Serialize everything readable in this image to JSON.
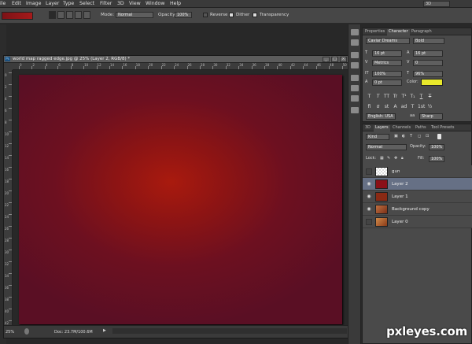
{
  "menu": {
    "items": [
      "ile",
      "Edit",
      "Image",
      "Layer",
      "Type",
      "Select",
      "Filter",
      "3D",
      "View",
      "Window",
      "Help"
    ],
    "workspace": "3D"
  },
  "options_bar": {
    "mode_label": "Mode:",
    "mode_value": "Normal",
    "opacity_label": "Opacity:",
    "opacity_value": "100%",
    "reverse_label": "Reverse",
    "dither_label": "Dither",
    "transparency_label": "Transparency",
    "reverse_checked": false,
    "dither_checked": true,
    "transparency_checked": true,
    "gradient_colors": [
      "#7d1216",
      "#a51a1a"
    ]
  },
  "document": {
    "title": "world map ragged edge.jpg @ 25% (Layer 2, RGB/8) *",
    "ps_icon": "Ps",
    "ruler_labels": [
      "0",
      "2",
      "4",
      "6",
      "8",
      "10",
      "12",
      "14",
      "16",
      "18",
      "20",
      "22",
      "24",
      "26",
      "28",
      "30",
      "32",
      "34",
      "36",
      "38",
      "40",
      "42",
      "44",
      "46",
      "48",
      "50"
    ],
    "zoom": "25%",
    "doc_size": "Doc: 23.7M/100.6M",
    "canvas_colors": {
      "center": "#a91a0e",
      "edge": "#5a0f24"
    }
  },
  "char_panel": {
    "tabs": [
      "Properties",
      "Character",
      "Paragraph"
    ],
    "active_tab": "Character",
    "font_family": "Caviar Dreams",
    "font_style": "Bold",
    "font_size": "16 pt",
    "leading": "16 pt",
    "kerning": "Metrics",
    "tracking": "0",
    "vertical_scale": "100%",
    "horizontal_scale": "96%",
    "baseline_shift": "0 pt",
    "color_label": "Color:",
    "color_value": "#e8e82b",
    "format_buttons": [
      "T",
      "T",
      "TT",
      "Tr",
      "T¹",
      "T₁",
      "T",
      "T"
    ],
    "format_buttons2": [
      "fi",
      "σ",
      "st",
      "A",
      "ad",
      "T",
      "1st",
      "½"
    ],
    "language": "English: USA",
    "antialias_prefix": "aa",
    "antialias": "Sharp"
  },
  "layers_panel": {
    "tabs": [
      "3D",
      "Layers",
      "Channels",
      "Paths",
      "Tool Presets"
    ],
    "active_tab": "Layers",
    "filter_kind": "Kind",
    "blend_mode": "Normal",
    "opacity_label": "Opacity:",
    "opacity": "100%",
    "lock_label": "Lock:",
    "fill_label": "Fill:",
    "fill": "100%",
    "layers": [
      {
        "name": "gun",
        "visible": false,
        "selected": false,
        "thumb": "checker"
      },
      {
        "name": "Layer 2",
        "visible": true,
        "selected": true,
        "thumb": "#8a1018"
      },
      {
        "name": "Layer 1",
        "visible": true,
        "selected": false,
        "thumb": "#8a2a14"
      },
      {
        "name": "Background copy",
        "visible": true,
        "selected": false,
        "thumb": "#a0603a"
      },
      {
        "name": "Layer 0",
        "visible": false,
        "selected": false,
        "thumb": "#b06a3a"
      }
    ]
  },
  "watermark": "pxleyes.com"
}
